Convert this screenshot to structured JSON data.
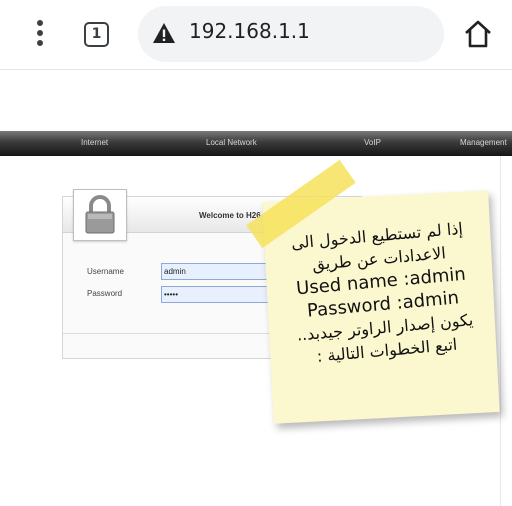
{
  "browser": {
    "tab_count": "1",
    "url": "192.168.1.1"
  },
  "navbar": {
    "items": [
      "Internet",
      "Local Network",
      "VoIP",
      "Management"
    ]
  },
  "login": {
    "welcome": "Welcome to H26",
    "username_label": "Username",
    "username_value": "admin",
    "password_label": "Password",
    "password_value": "•••••"
  },
  "note": {
    "lines": [
      "إذا لم تستطيع الدخول الى",
      "الاعدادات عن طريق",
      "Used name :admin",
      "Password :admin",
      "يكون إصدار الراوتر جيدبد..",
      "اتبع الخطوات التالية :"
    ],
    "colors": {
      "paper": "#fbf7cf",
      "tape": "#f6e25a"
    }
  }
}
